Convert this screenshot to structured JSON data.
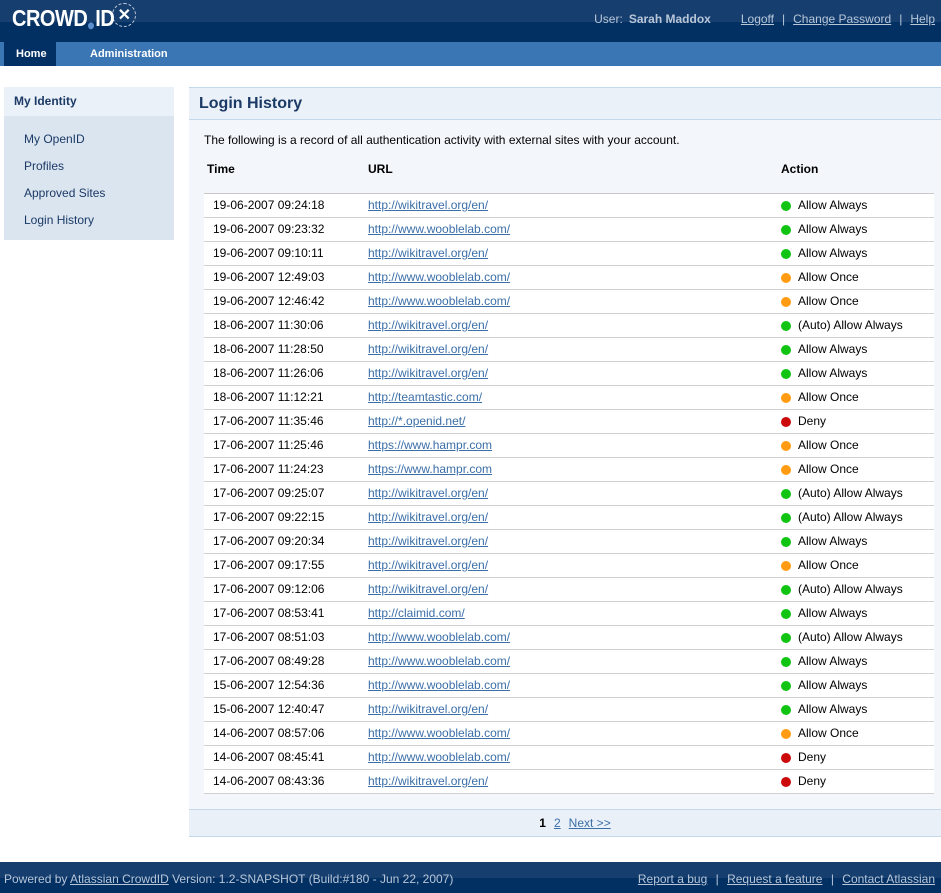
{
  "header": {
    "logo_text_left": "CROWD",
    "logo_text_right": "ID",
    "logo_badge": "✕",
    "user_label": "User:",
    "user_name": "Sarah Maddox",
    "links": [
      "Logoff",
      "Change Password",
      "Help"
    ],
    "separator": "|"
  },
  "nav": {
    "items": [
      {
        "label": "Home",
        "active": true
      },
      {
        "label": "Administration",
        "active": false
      }
    ]
  },
  "sidebar": {
    "title": "My Identity",
    "items": [
      {
        "label": "My OpenID"
      },
      {
        "label": "Profiles"
      },
      {
        "label": "Approved Sites"
      },
      {
        "label": "Login History"
      }
    ]
  },
  "main": {
    "title": "Login History",
    "intro": "The following is a record of all authentication activity with external sites with your account.",
    "columns": [
      "Time",
      "URL",
      "Action"
    ],
    "status_colors": {
      "allow_always": "#11c411",
      "allow_once": "#ff9c11",
      "deny": "#cc0a0a"
    },
    "rows": [
      {
        "time": "19-06-2007 09:24:18",
        "url": "http://wikitravel.org/en/",
        "action": "Allow Always",
        "status": "allow_always"
      },
      {
        "time": "19-06-2007 09:23:32",
        "url": "http://www.wooblelab.com/",
        "action": "Allow Always",
        "status": "allow_always"
      },
      {
        "time": "19-06-2007 09:10:11",
        "url": "http://wikitravel.org/en/",
        "action": "Allow Always",
        "status": "allow_always"
      },
      {
        "time": "19-06-2007 12:49:03",
        "url": "http://www.wooblelab.com/",
        "action": "Allow Once",
        "status": "allow_once"
      },
      {
        "time": "19-06-2007 12:46:42",
        "url": "http://www.wooblelab.com/",
        "action": "Allow Once",
        "status": "allow_once"
      },
      {
        "time": "18-06-2007 11:30:06",
        "url": "http://wikitravel.org/en/",
        "action": "(Auto) Allow Always",
        "status": "allow_always"
      },
      {
        "time": "18-06-2007 11:28:50",
        "url": "http://wikitravel.org/en/",
        "action": "Allow Always",
        "status": "allow_always"
      },
      {
        "time": "18-06-2007 11:26:06",
        "url": "http://wikitravel.org/en/",
        "action": "Allow Always",
        "status": "allow_always"
      },
      {
        "time": "18-06-2007 11:12:21",
        "url": "http://teamtastic.com/",
        "action": "Allow Once",
        "status": "allow_once"
      },
      {
        "time": "17-06-2007 11:35:46",
        "url": "http://*.openid.net/",
        "action": "Deny",
        "status": "deny"
      },
      {
        "time": "17-06-2007 11:25:46",
        "url": "https://www.hampr.com",
        "action": "Allow Once",
        "status": "allow_once"
      },
      {
        "time": "17-06-2007 11:24:23",
        "url": "https://www.hampr.com",
        "action": "Allow Once",
        "status": "allow_once"
      },
      {
        "time": "17-06-2007 09:25:07",
        "url": "http://wikitravel.org/en/",
        "action": "(Auto) Allow Always",
        "status": "allow_always"
      },
      {
        "time": "17-06-2007 09:22:15",
        "url": "http://wikitravel.org/en/",
        "action": "(Auto) Allow Always",
        "status": "allow_always"
      },
      {
        "time": "17-06-2007 09:20:34",
        "url": "http://wikitravel.org/en/",
        "action": "Allow Always",
        "status": "allow_always"
      },
      {
        "time": "17-06-2007 09:17:55",
        "url": "http://wikitravel.org/en/",
        "action": "Allow Once",
        "status": "allow_once"
      },
      {
        "time": "17-06-2007 09:12:06",
        "url": "http://wikitravel.org/en/",
        "action": "(Auto) Allow Always",
        "status": "allow_always"
      },
      {
        "time": "17-06-2007 08:53:41",
        "url": "http://claimid.com/",
        "action": "Allow Always",
        "status": "allow_always"
      },
      {
        "time": "17-06-2007 08:51:03",
        "url": "http://www.wooblelab.com/",
        "action": "(Auto) Allow Always",
        "status": "allow_always"
      },
      {
        "time": "17-06-2007 08:49:28",
        "url": "http://www.wooblelab.com/",
        "action": "Allow Always",
        "status": "allow_always"
      },
      {
        "time": "15-06-2007 12:54:36",
        "url": "http://www.wooblelab.com/",
        "action": "Allow Always",
        "status": "allow_always"
      },
      {
        "time": "15-06-2007 12:40:47",
        "url": "http://wikitravel.org/en/",
        "action": "Allow Always",
        "status": "allow_always"
      },
      {
        "time": "14-06-2007 08:57:06",
        "url": "http://www.wooblelab.com/",
        "action": "Allow Once",
        "status": "allow_once"
      },
      {
        "time": "14-06-2007 08:45:41",
        "url": "http://www.wooblelab.com/",
        "action": "Deny",
        "status": "deny"
      },
      {
        "time": "14-06-2007 08:43:36",
        "url": "http://wikitravel.org/en/",
        "action": "Deny",
        "status": "deny"
      }
    ],
    "pager": {
      "current": "1",
      "pages": [
        "2"
      ],
      "next": "Next >>"
    }
  },
  "footer": {
    "powered_prefix": "Powered by",
    "powered_link": "Atlassian CrowdID",
    "version": "Version: 1.2-SNAPSHOT (Build:#180 - Jun 22, 2007)",
    "links": [
      "Report a bug",
      "Request a feature",
      "Contact Atlassian"
    ],
    "separator": "|"
  }
}
